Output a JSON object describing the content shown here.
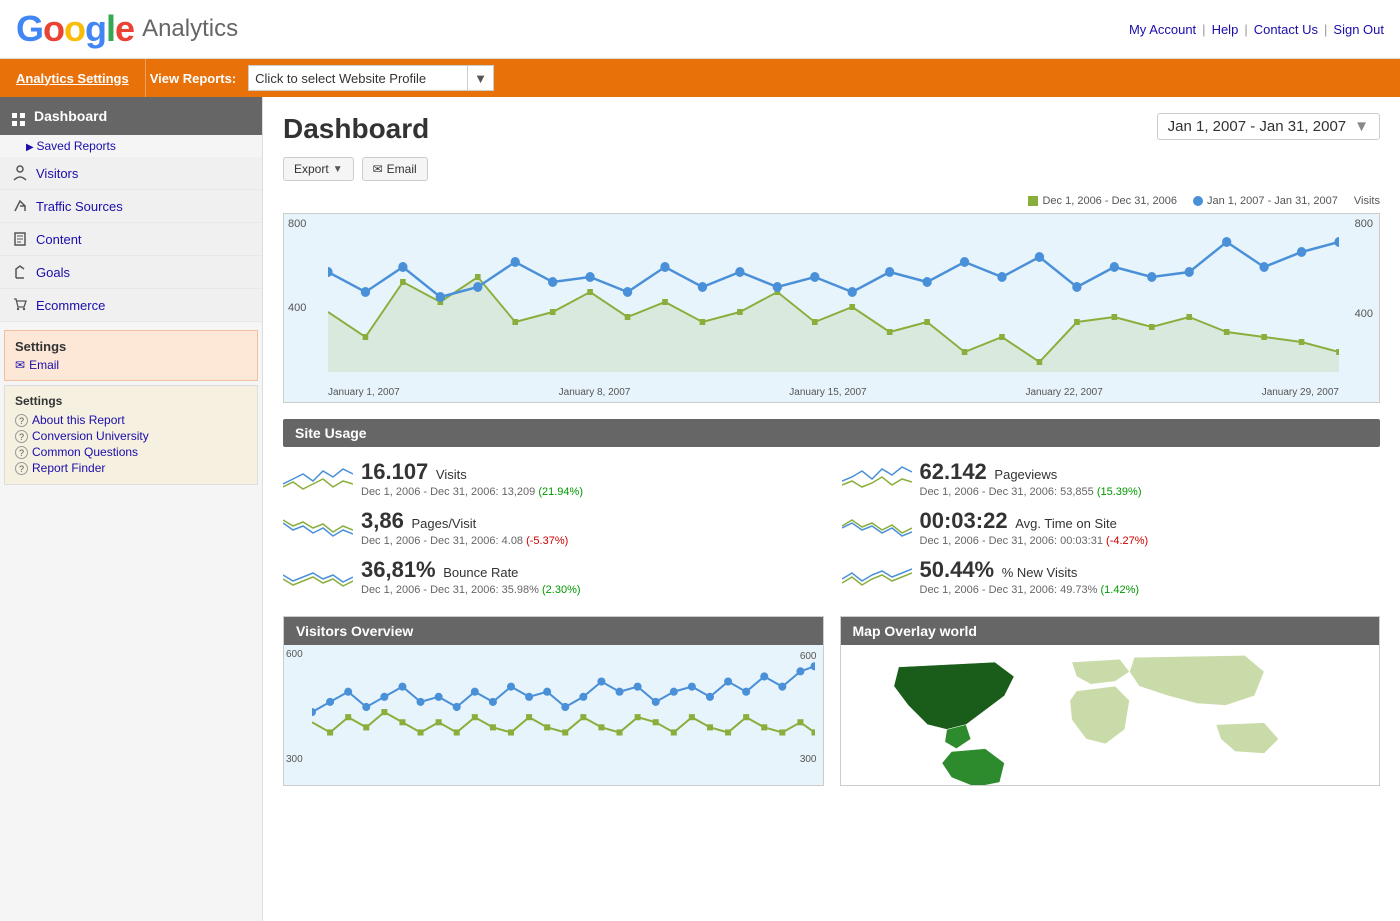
{
  "header": {
    "logo_google": "Google",
    "logo_analytics": "Analytics",
    "nav": {
      "my_account": "My Account",
      "help": "Help",
      "contact_us": "Contact Us",
      "sign_out": "Sign Out"
    }
  },
  "orange_bar": {
    "analytics_settings": "Analytics Settings",
    "view_reports": "View Reports:",
    "profile_placeholder": "Click to select Website Profile"
  },
  "sidebar": {
    "dashboard_label": "Dashboard",
    "saved_reports": "Saved Reports",
    "nav_items": [
      {
        "id": "visitors",
        "label": "Visitors",
        "icon": "👤"
      },
      {
        "id": "traffic-sources",
        "label": "Traffic Sources",
        "icon": "↗"
      },
      {
        "id": "content",
        "label": "Content",
        "icon": "□"
      },
      {
        "id": "goals",
        "label": "Goals",
        "icon": "⚑"
      },
      {
        "id": "ecommerce",
        "label": "Ecommerce",
        "icon": "🛒"
      }
    ],
    "settings_section": {
      "title": "Settings",
      "email_label": "Email"
    },
    "settings_box": {
      "title": "Settings",
      "links": [
        "About this Report",
        "Conversion University",
        "Common Questions",
        "Report Finder"
      ]
    }
  },
  "main": {
    "title": "Dashboard",
    "date_range": "Jan 1, 2007 - Jan 31, 2007",
    "toolbar": {
      "export": "Export",
      "email": "Email"
    },
    "chart": {
      "legend_prev_label": "Dec 1, 2006 - Dec 31, 2006",
      "legend_curr_label": "Jan 1, 2007 - Jan 31, 2007",
      "visits_label": "Visits",
      "y_high": "800",
      "y_mid": "400",
      "x_labels": [
        "January 1, 2007",
        "January 8, 2007",
        "January 15, 2007",
        "January 22, 2007",
        "January 29, 2007"
      ],
      "y_right_high": "800",
      "y_right_low": "400"
    },
    "site_usage": {
      "title": "Site Usage",
      "metrics": [
        {
          "value": "16.107",
          "label": "Visits",
          "comparison": "Dec 1, 2006 - Dec 31, 2006: 13,209",
          "change": "(21.94%)",
          "positive": true
        },
        {
          "value": "62.142",
          "label": "Pageviews",
          "comparison": "Dec 1, 2006 - Dec 31, 2006: 53,855",
          "change": "(15.39%)",
          "positive": true
        },
        {
          "value": "3,86",
          "label": "Pages/Visit",
          "comparison": "Dec 1, 2006 - Dec 31, 2006: 4.08",
          "change": "(-5.37%)",
          "positive": false
        },
        {
          "value": "00:03:22",
          "label": "Avg. Time on Site",
          "comparison": "Dec 1, 2006 - Dec 31, 2006: 00:03:31",
          "change": "(-4.27%)",
          "positive": false
        },
        {
          "value": "36,81%",
          "label": "Bounce Rate",
          "comparison": "Dec 1, 2006 - Dec 31, 2006: 35.98%",
          "change": "(2.30%)",
          "positive": true
        },
        {
          "value": "50.44%",
          "label": "% New Visits",
          "comparison": "Dec 1, 2006 - Dec 31, 2006: 49.73%",
          "change": "(1.42%)",
          "positive": true
        }
      ]
    },
    "panels": {
      "visitors_overview": "Visitors Overview",
      "map_overlay": "Map Overlay world"
    }
  }
}
